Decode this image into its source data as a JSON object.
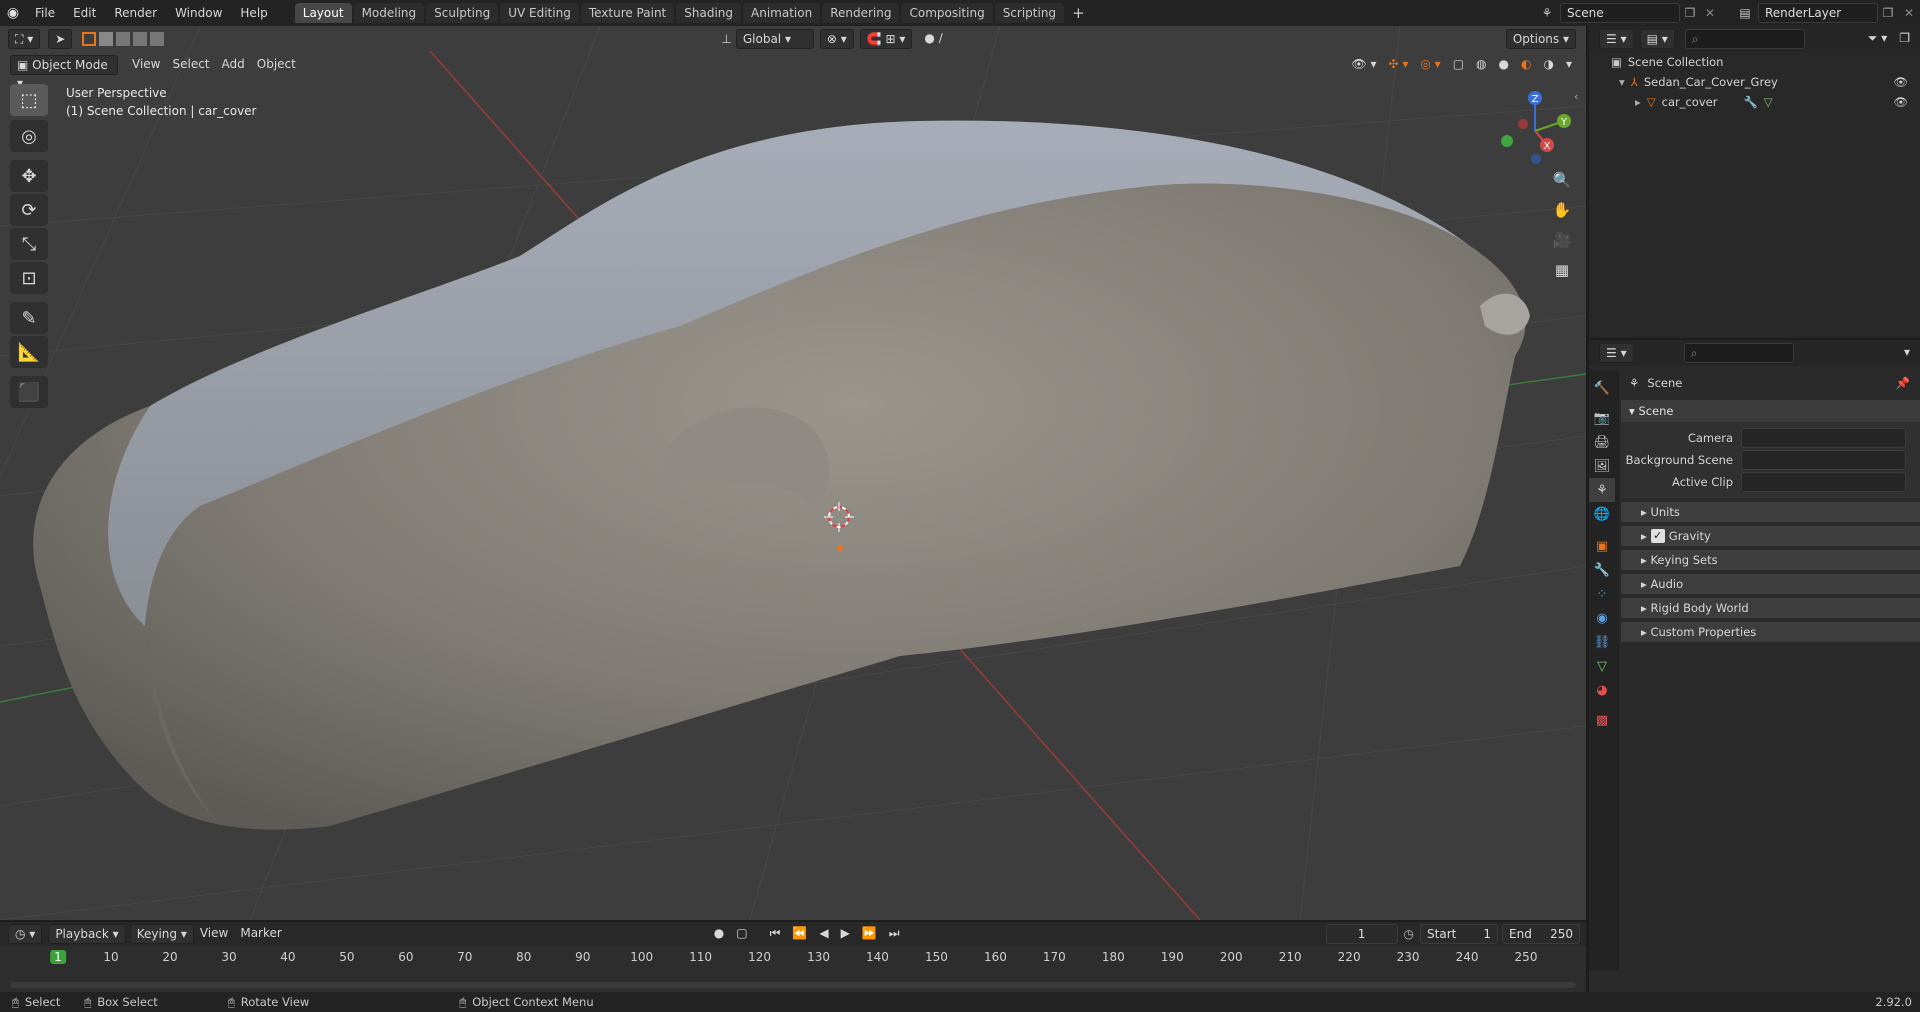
{
  "topbar": {
    "menus": [
      "File",
      "Edit",
      "Render",
      "Window",
      "Help"
    ],
    "workspaces": [
      "Layout",
      "Modeling",
      "Sculpting",
      "UV Editing",
      "Texture Paint",
      "Shading",
      "Animation",
      "Rendering",
      "Compositing",
      "Scripting"
    ],
    "active_workspace": "Layout",
    "add_tab": "+",
    "scene_name": "Scene",
    "view_layer": "RenderLayer"
  },
  "viewport": {
    "transform_orientation": "Global",
    "options_label": "Options",
    "mode": "Object Mode",
    "menus": [
      "View",
      "Select",
      "Add",
      "Object"
    ],
    "info_line1": "User Perspective",
    "info_line2": "(1) Scene Collection | car_cover",
    "gizmo_labels": {
      "z": "Z",
      "y": "Y",
      "x": "X"
    }
  },
  "outliner": {
    "root": "Scene Collection",
    "collection": "Sedan_Car_Cover_Grey",
    "object": "car_cover"
  },
  "properties": {
    "context": "Scene",
    "panel_title": "Scene",
    "fields": [
      {
        "label": "Camera",
        "value": ""
      },
      {
        "label": "Background Scene",
        "value": ""
      },
      {
        "label": "Active Clip",
        "value": ""
      }
    ],
    "subpanels": [
      "Units",
      "Gravity",
      "Keying Sets",
      "Audio",
      "Rigid Body World",
      "Custom Properties"
    ],
    "gravity_enabled": true
  },
  "timeline": {
    "menus": [
      "Playback",
      "Keying",
      "View",
      "Marker"
    ],
    "current_frame": "1",
    "start_label": "Start",
    "start_value": "1",
    "end_label": "End",
    "end_value": "250",
    "ticks": [
      "1",
      "10",
      "20",
      "30",
      "40",
      "50",
      "60",
      "70",
      "80",
      "90",
      "100",
      "110",
      "120",
      "130",
      "140",
      "150",
      "160",
      "170",
      "180",
      "190",
      "200",
      "210",
      "220",
      "230",
      "240",
      "250"
    ]
  },
  "statusbar": {
    "items": [
      "Select",
      "Box Select",
      "Rotate View",
      "Object Context Menu"
    ],
    "version": "2.92.0"
  },
  "colors": {
    "accent_orange": "#e8741c",
    "active_tab": "#474747",
    "frame_green": "#3aa33a"
  }
}
